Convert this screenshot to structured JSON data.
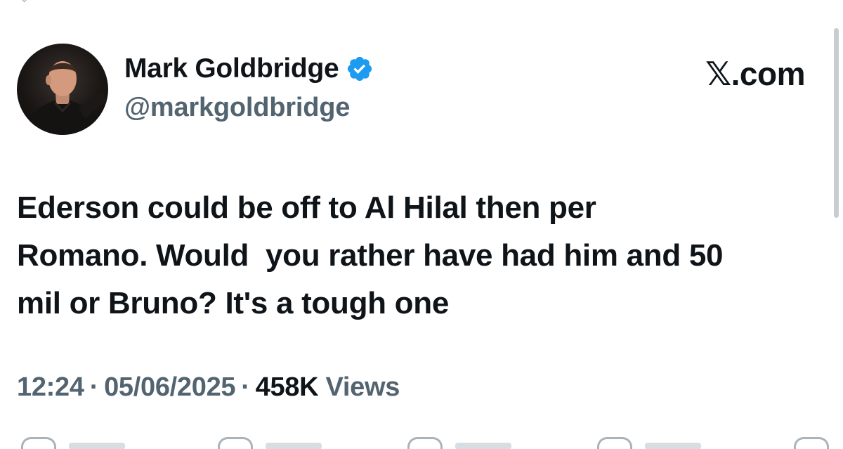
{
  "user": {
    "display_name": "Mark Goldbridge",
    "handle": "@markgoldbridge",
    "verified_icon": "verified-badge-icon",
    "verified_color": "#1d9bf0"
  },
  "brand": {
    "label": "𝕏.com"
  },
  "tweet": {
    "text": "Ederson could be off to Al Hilal then per\nRomano. Would  you rather have had him and 50\nmil or Bruno? It's a tough one"
  },
  "meta": {
    "time": "12:24",
    "date": "05/06/2025",
    "views_count": "458K",
    "views_label": "Views",
    "separator": "·"
  },
  "actions": [
    {
      "icon": "reply-icon"
    },
    {
      "icon": "retweet-icon"
    },
    {
      "icon": "like-icon"
    },
    {
      "icon": "bookmark-icon"
    },
    {
      "icon": "share-icon"
    }
  ],
  "colors": {
    "text_primary": "#0f1419",
    "text_secondary": "#536471"
  }
}
